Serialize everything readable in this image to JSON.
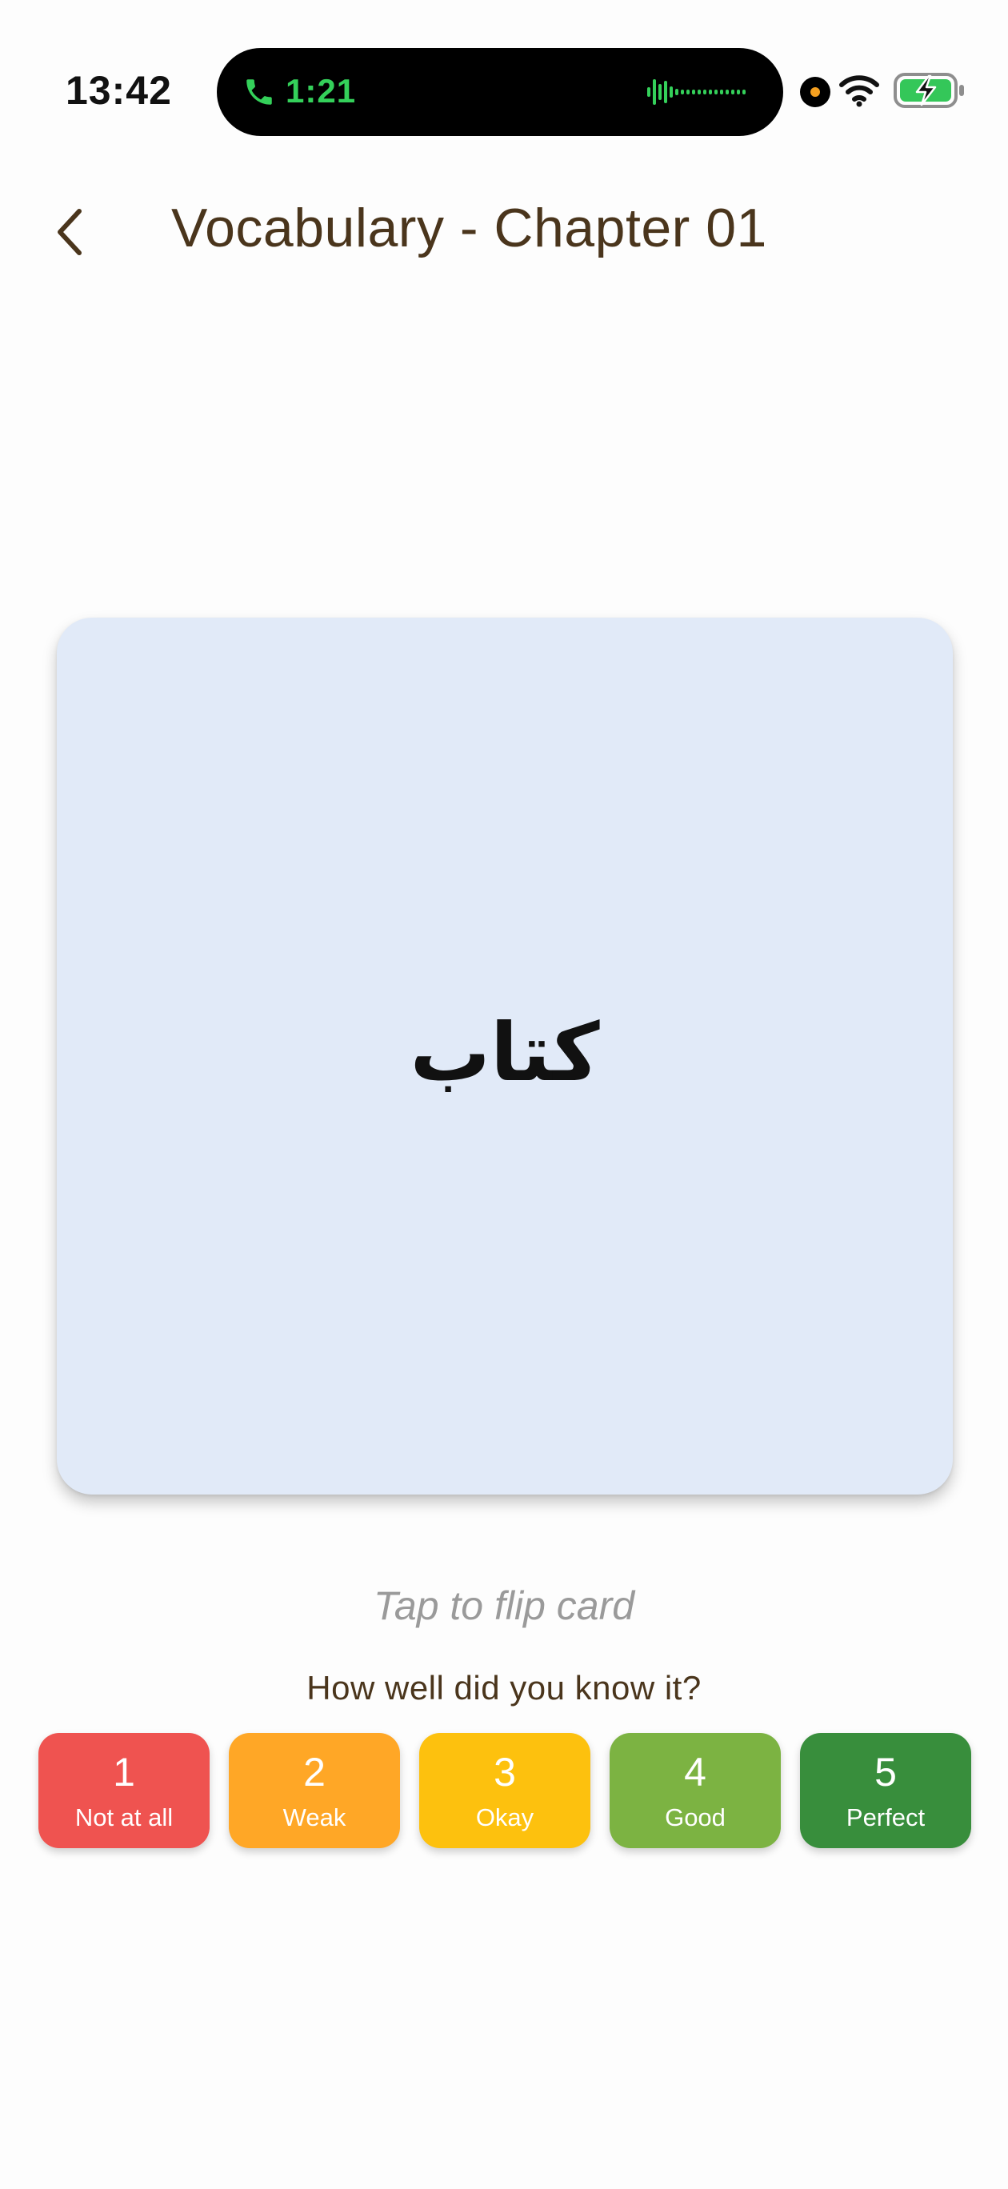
{
  "status_bar": {
    "time": "13:42",
    "call_timer": "1:21",
    "call_color": "#34d05a"
  },
  "header": {
    "back_icon": "chevron-left-icon",
    "title": "Vocabulary - Chapter 01"
  },
  "flashcard": {
    "word": "كتاب",
    "background": "#e1eaf8"
  },
  "flip_hint": "Tap to flip card",
  "rating": {
    "question": "How well did you know it?",
    "options": [
      {
        "number": "1",
        "label": "Not at all",
        "color": "#ef5350"
      },
      {
        "number": "2",
        "label": "Weak",
        "color": "#ffa726"
      },
      {
        "number": "3",
        "label": "Okay",
        "color": "#fdc10e"
      },
      {
        "number": "4",
        "label": "Good",
        "color": "#7cb342"
      },
      {
        "number": "5",
        "label": "Perfect",
        "color": "#388e3c"
      }
    ]
  },
  "colors": {
    "title": "#4a351c",
    "hint": "#9a9a9a"
  }
}
